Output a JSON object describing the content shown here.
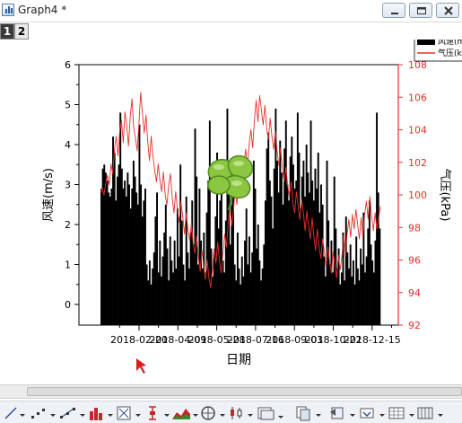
{
  "window": {
    "title": "Graph4 *"
  },
  "layers": [
    {
      "label": "1",
      "active": true
    },
    {
      "label": "2",
      "active": false
    }
  ],
  "colors": {
    "bars": "#000000",
    "line": "#e8302a",
    "right_axis": "#e8302a",
    "left_axis": "#000000",
    "cursor": "#d81e1e"
  },
  "icons": [
    "minimize-icon",
    "restore-icon",
    "close-icon",
    "line-tool-icon",
    "scatter-tool-icon",
    "line-symbol-tool-icon",
    "column-tool-icon",
    "box-tool-icon",
    "error-bar-tool-icon",
    "area-tool-icon",
    "polar-tool-icon",
    "stock-tool-icon",
    "merge-tool-icon",
    "layer-tool-icon",
    "group-tool-icon",
    "dropdown-tool-icon",
    "frame-tool-icon",
    "grid-tool-icon"
  ],
  "chart_data": {
    "type": "bar",
    "title": "",
    "xlabel": "日期",
    "ylabel": "风速(m/s)",
    "ylim": [
      0,
      6
    ],
    "y_ticks": [
      "0",
      "1",
      "2",
      "3",
      "4",
      "5",
      "6"
    ],
    "y2label": "气压(kPa)",
    "y2lim": [
      92,
      108
    ],
    "y2_ticks": [
      "92",
      "94",
      "96",
      "98",
      "100",
      "102",
      "104",
      "106",
      "108"
    ],
    "x_tick_labels": [
      "2018-02-20",
      "2018-04-09",
      "2018-05-28",
      "2018-07-16",
      "2018-09-03",
      "2018-10-22",
      "2018-12-15"
    ],
    "legend": {
      "position": "top-right",
      "entries": [
        "风速(m/s)",
        "气压(kPa)"
      ]
    },
    "grid": false,
    "x_start_date": "2018-01-01",
    "series": [
      {
        "name": "风速(m/s)",
        "type": "bar",
        "axis": "left",
        "values": [
          2.9,
          3.4,
          3.5,
          3.3,
          3.1,
          2.8,
          2.7,
          2.9,
          4.2,
          3.8,
          2.6,
          3.2,
          3.5,
          4.8,
          3.4,
          2.9,
          3.1,
          2.7,
          3.3,
          3.0,
          2.4,
          2.9,
          3.6,
          3.2,
          2.8,
          2.5,
          4.5,
          3.0,
          2.2,
          2.6,
          2.9,
          1.0,
          0.6,
          1.1,
          0.5,
          0.9,
          1.3,
          2.2,
          2.8,
          0.8,
          1.6,
          0.7,
          1.2,
          1.8,
          2.5,
          1.4,
          0.6,
          1.7,
          1.1,
          0.8,
          1.6,
          0.9,
          2.4,
          1.2,
          3.5,
          2.1,
          1.0,
          0.6,
          2.7,
          1.3,
          0.9,
          1.8,
          2.6,
          1.5,
          4.4,
          3.2,
          1.0,
          2.9,
          1.6,
          0.9,
          1.8,
          0.8,
          2.3,
          3.1,
          4.6,
          1.4,
          0.7,
          1.3,
          2.2,
          3.8,
          1.9,
          2.6,
          3.4,
          1.1,
          0.8,
          2.1,
          4.9,
          2.8,
          1.5,
          2.5,
          3.2,
          1.0,
          0.6,
          1.8,
          0.9,
          0.5,
          1.2,
          0.7,
          1.6,
          2.4,
          1.0,
          1.7,
          0.8,
          1.3,
          3.6,
          2.9,
          1.4,
          2.0,
          1.1,
          0.6,
          0.9,
          1.5,
          2.6,
          3.9,
          4.3,
          3.1,
          2.7,
          1.9,
          3.4,
          4.9,
          3.6,
          2.8,
          4.1,
          3.3,
          2.5,
          3.9,
          4.6,
          3.0,
          2.6,
          3.7,
          4.2,
          3.5,
          2.9,
          3.1,
          4.8,
          3.8,
          2.4,
          3.2,
          3.6,
          2.7,
          4.0,
          3.3,
          2.8,
          4.6,
          3.1,
          2.6,
          3.4,
          2.9,
          3.8,
          2.3,
          3.0,
          2.5,
          1.2,
          0.7,
          3.6,
          2.1,
          1.0,
          1.6,
          0.8,
          3.2,
          1.9,
          0.9,
          1.4,
          0.5,
          0.8,
          1.8,
          0.6,
          2.2,
          1.3,
          0.9,
          1.5,
          0.7,
          1.1,
          0.5,
          1.7,
          0.9,
          0.6,
          1.4,
          1.0,
          2.3,
          0.8,
          1.2,
          1.9,
          2.6,
          1.5,
          1.1,
          0.8,
          1.6,
          4.8,
          2.8,
          1.9
        ]
      },
      {
        "name": "气压(kPa)",
        "type": "line",
        "axis": "right",
        "values": [
          100.1,
          100.4,
          100.0,
          100.7,
          101.2,
          100.6,
          101.9,
          101.3,
          102.8,
          103.6,
          102.4,
          103.9,
          104.6,
          103.2,
          105.1,
          104.3,
          103.0,
          104.8,
          105.9,
          104.1,
          103.5,
          102.7,
          104.4,
          106.3,
          105.0,
          103.8,
          104.9,
          103.3,
          102.1,
          103.6,
          102.4,
          101.5,
          100.8,
          101.9,
          100.9,
          100.2,
          101.4,
          100.0,
          99.4,
          100.6,
          101.3,
          99.8,
          98.9,
          100.2,
          99.1,
          98.3,
          99.6,
          98.7,
          97.6,
          98.9,
          97.9,
          97.2,
          98.3,
          97.0,
          96.4,
          97.5,
          96.1,
          95.3,
          96.6,
          95.6,
          94.8,
          96.0,
          94.9,
          94.3,
          95.4,
          96.7,
          95.8,
          97.1,
          96.0,
          95.2,
          96.4,
          97.6,
          96.8,
          98.2,
          99.4,
          98.1,
          99.0,
          100.3,
          99.4,
          100.8,
          101.6,
          100.5,
          101.9,
          102.8,
          101.7,
          103.1,
          104.0,
          102.9,
          104.6,
          105.8,
          104.5,
          106.1,
          105.2,
          104.3,
          105.5,
          104.1,
          103.4,
          104.7,
          103.6,
          102.8,
          103.9,
          102.7,
          101.8,
          102.9,
          101.6,
          100.8,
          101.7,
          100.6,
          99.9,
          100.8,
          99.6,
          98.9,
          100.2,
          99.3,
          98.5,
          99.7,
          98.9,
          97.8,
          99.0,
          98.1,
          97.3,
          98.6,
          97.4,
          96.6,
          97.9,
          96.8,
          96.1,
          97.3,
          96.5,
          95.6,
          96.8,
          95.9,
          95.2,
          96.5,
          95.7,
          94.9,
          96.3,
          95.4,
          96.2,
          97.5,
          96.3,
          97.6,
          98.5,
          97.4,
          98.8,
          97.9,
          99.1,
          98.2,
          97.3,
          98.6,
          97.4,
          98.8,
          99.6,
          98.5,
          99.9,
          98.7,
          97.8,
          98.9,
          97.9,
          98.6,
          99.3
        ]
      }
    ]
  }
}
